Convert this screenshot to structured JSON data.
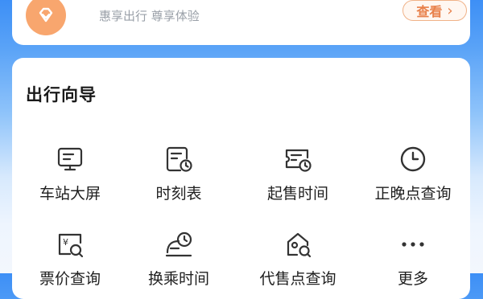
{
  "member_banner": {
    "subtitle": "惠享出行 尊享体验",
    "button_label": "查看",
    "button_chevron": "›"
  },
  "guide": {
    "title": "出行向导",
    "services": [
      {
        "id": "station-screen",
        "label": "车站大屏",
        "icon": "monitor-icon"
      },
      {
        "id": "timetable",
        "label": "时刻表",
        "icon": "calendar-clock-icon"
      },
      {
        "id": "sale-time",
        "label": "起售时间",
        "icon": "ticket-clock-icon"
      },
      {
        "id": "punctuality",
        "label": "正晚点查询",
        "icon": "clock-icon"
      },
      {
        "id": "fare-query",
        "label": "票价查询",
        "icon": "fare-search-icon"
      },
      {
        "id": "transfer-time",
        "label": "换乘时间",
        "icon": "train-clock-icon"
      },
      {
        "id": "agency-query",
        "label": "代售点查询",
        "icon": "house-search-icon"
      },
      {
        "id": "more",
        "label": "更多",
        "icon": "more-dots-icon"
      }
    ]
  },
  "colors": {
    "accent_orange": "#f8a66e",
    "icon_stroke": "#333333",
    "header_blue": "#3d8ff6"
  }
}
